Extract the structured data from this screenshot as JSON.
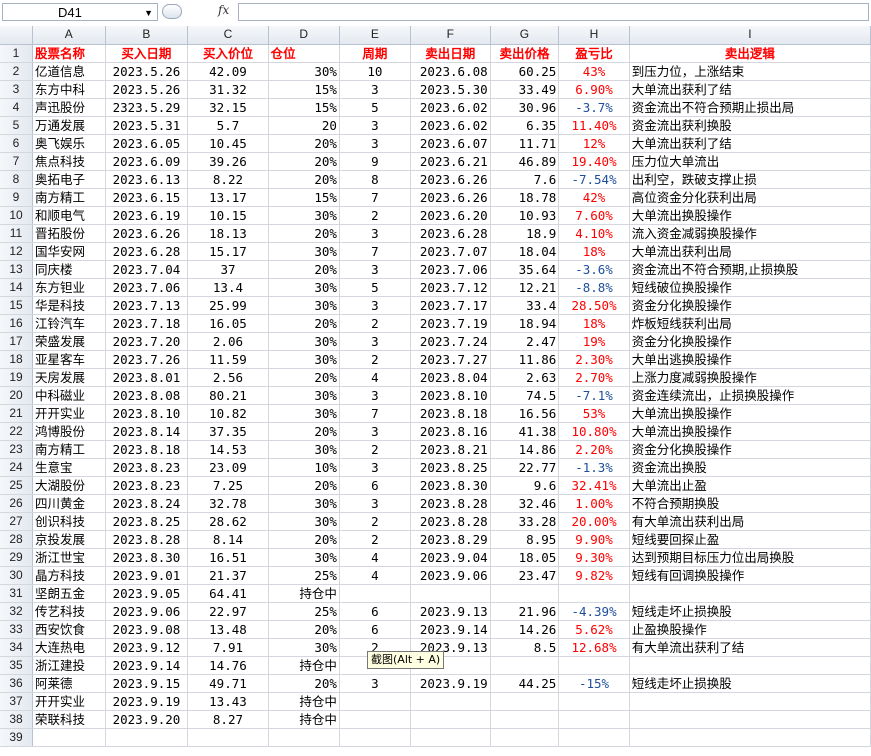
{
  "formula_bar": {
    "cell_ref": "D41",
    "fx_label": "fx",
    "formula": ""
  },
  "columns": [
    "A",
    "B",
    "C",
    "D",
    "E",
    "F",
    "G",
    "H",
    "I"
  ],
  "header": [
    "股票名称",
    "买入日期",
    "买入价位",
    "仓位",
    "周期",
    "卖出日期",
    "卖出价格",
    "盈亏比",
    "卖出逻辑"
  ],
  "rows": [
    [
      "亿道信息",
      "2023.5.26",
      "42.09",
      "30%",
      "10",
      "2023.6.08",
      "60.25",
      "43%",
      "到压力位，上涨结束"
    ],
    [
      "东方中科",
      "2023.5.26",
      "31.32",
      "15%",
      "3",
      "2023.5.30",
      "33.49",
      "6.90%",
      "大单流出获利了结"
    ],
    [
      "声迅股份",
      "2323.5.29",
      "32.15",
      "15%",
      "5",
      "2023.6.02",
      "30.96",
      "-3.7%",
      "资金流出不符合预期止损出局"
    ],
    [
      "万通发展",
      "2023.5.31",
      "5.7",
      "20",
      "3",
      "2023.6.02",
      "6.35",
      "11.40%",
      "资金流出获利换股"
    ],
    [
      "奥飞娱乐",
      "2023.6.05",
      "10.45",
      "20%",
      "3",
      "2023.6.07",
      "11.71",
      "12%",
      "大单流出获利了结"
    ],
    [
      "焦点科技",
      "2023.6.09",
      "39.26",
      "20%",
      "9",
      "2023.6.21",
      "46.89",
      "19.40%",
      "压力位大单流出"
    ],
    [
      "奥拓电子",
      "2023.6.13",
      "8.22",
      "20%",
      "8",
      "2023.6.26",
      "7.6",
      "-7.54%",
      "出利空，跌破支撑止损"
    ],
    [
      "南方精工",
      "2023.6.15",
      "13.17",
      "15%",
      "7",
      "2023.6.26",
      "18.78",
      "42%",
      "高位资金分化获利出局"
    ],
    [
      "和顺电气",
      "2023.6.19",
      "10.15",
      "30%",
      "2",
      "2023.6.20",
      "10.93",
      "7.60%",
      "大单流出换股操作"
    ],
    [
      "晋拓股份",
      "2023.6.26",
      "18.13",
      "20%",
      "3",
      "2023.6.28",
      "18.9",
      "4.10%",
      "流入资金减弱换股操作"
    ],
    [
      "国华安网",
      "2023.6.28",
      "15.17",
      "30%",
      "7",
      "2023.7.07",
      "18.04",
      "18%",
      "大单流出获利出局"
    ],
    [
      "同庆楼",
      "2023.7.04",
      "37",
      "20%",
      "3",
      "2023.7.06",
      "35.64",
      "-3.6%",
      "资金流出不符合预期,止损换股"
    ],
    [
      "东方钽业",
      "2023.7.06",
      "13.4",
      "30%",
      "5",
      "2023.7.12",
      "12.21",
      "-8.8%",
      "短线破位换股操作"
    ],
    [
      "华是科技",
      "2023.7.13",
      "25.99",
      "30%",
      "3",
      "2023.7.17",
      "33.4",
      "28.50%",
      "资金分化换股操作"
    ],
    [
      "江铃汽车",
      "2023.7.18",
      "16.05",
      "20%",
      "2",
      "2023.7.19",
      "18.94",
      "18%",
      "炸板短线获利出局"
    ],
    [
      "荣盛发展",
      "2023.7.20",
      "2.06",
      "30%",
      "3",
      "2023.7.24",
      "2.47",
      "19%",
      "资金分化换股操作"
    ],
    [
      "亚星客车",
      "2023.7.26",
      "11.59",
      "30%",
      "2",
      "2023.7.27",
      "11.86",
      "2.30%",
      "大单出逃换股操作"
    ],
    [
      "天房发展",
      "2023.8.01",
      "2.56",
      "20%",
      "4",
      "2023.8.04",
      "2.63",
      "2.70%",
      "上涨力度减弱换股操作"
    ],
    [
      "中科磁业",
      "2023.8.08",
      "80.21",
      "30%",
      "3",
      "2023.8.10",
      "74.5",
      "-7.1%",
      "资金连续流出，止损换股操作"
    ],
    [
      "开开实业",
      "2023.8.10",
      "10.82",
      "30%",
      "7",
      "2023.8.18",
      "16.56",
      "53%",
      "大单流出换股操作"
    ],
    [
      "鸿博股份",
      "2023.8.14",
      "37.35",
      "20%",
      "3",
      "2023.8.16",
      "41.38",
      "10.80%",
      "大单流出换股操作"
    ],
    [
      "南方精工",
      "2023.8.18",
      "14.53",
      "30%",
      "2",
      "2023.8.21",
      "14.86",
      "2.20%",
      "资金分化换股操作"
    ],
    [
      "生意宝",
      "2023.8.23",
      "23.09",
      "10%",
      "3",
      "2023.8.25",
      "22.77",
      "-1.3%",
      "资金流出换股"
    ],
    [
      "大湖股份",
      "2023.8.23",
      "7.25",
      "20%",
      "6",
      "2023.8.30",
      "9.6",
      "32.41%",
      "大单流出止盈"
    ],
    [
      "四川黄金",
      "2023.8.24",
      "32.78",
      "30%",
      "3",
      "2023.8.28",
      "32.46",
      "1.00%",
      "不符合预期换股"
    ],
    [
      "创识科技",
      "2023.8.25",
      "28.62",
      "30%",
      "2",
      "2023.8.28",
      "33.28",
      "20.00%",
      "有大单流出获利出局"
    ],
    [
      "京投发展",
      "2023.8.28",
      "8.14",
      "20%",
      "2",
      "2023.8.29",
      "8.95",
      "9.90%",
      "短线要回探止盈"
    ],
    [
      "浙江世宝",
      "2023.8.30",
      "16.51",
      "30%",
      "4",
      "2023.9.04",
      "18.05",
      "9.30%",
      "达到预期目标压力位出局换股"
    ],
    [
      "晶方科技",
      "2023.9.01",
      "21.37",
      "25%",
      "4",
      "2023.9.06",
      "23.47",
      "9.82%",
      "短线有回调换股操作"
    ],
    [
      "坚朗五金",
      "2023.9.05",
      "64.41",
      "持仓中",
      "",
      "",
      "",
      "",
      ""
    ],
    [
      "传艺科技",
      "2023.9.06",
      "22.97",
      "25%",
      "6",
      "2023.9.13",
      "21.96",
      "-4.39%",
      "短线走坏止损换股"
    ],
    [
      "西安饮食",
      "2023.9.08",
      "13.48",
      "20%",
      "6",
      "2023.9.14",
      "14.26",
      "5.62%",
      "止盈换股操作"
    ],
    [
      "大连热电",
      "2023.9.12",
      "7.91",
      "30%",
      "2",
      "2023.9.13",
      "8.5",
      "12.68%",
      "有大单流出获利了结"
    ],
    [
      "浙江建投",
      "2023.9.14",
      "14.76",
      "持仓中",
      "",
      "",
      "",
      "",
      ""
    ],
    [
      "阿莱德",
      "2023.9.15",
      "49.71",
      "20%",
      "3",
      "2023.9.19",
      "44.25",
      "-15%",
      "短线走坏止损换股"
    ],
    [
      "开开实业",
      "2023.9.19",
      "13.43",
      "持仓中",
      "",
      "",
      "",
      "",
      ""
    ],
    [
      "荣联科技",
      "2023.9.20",
      "8.27",
      "持仓中",
      "",
      "",
      "",
      "",
      ""
    ],
    [
      "",
      "",
      "",
      "",
      "",
      "",
      "",
      "",
      ""
    ]
  ],
  "tooltip": "截图(Alt + A)"
}
